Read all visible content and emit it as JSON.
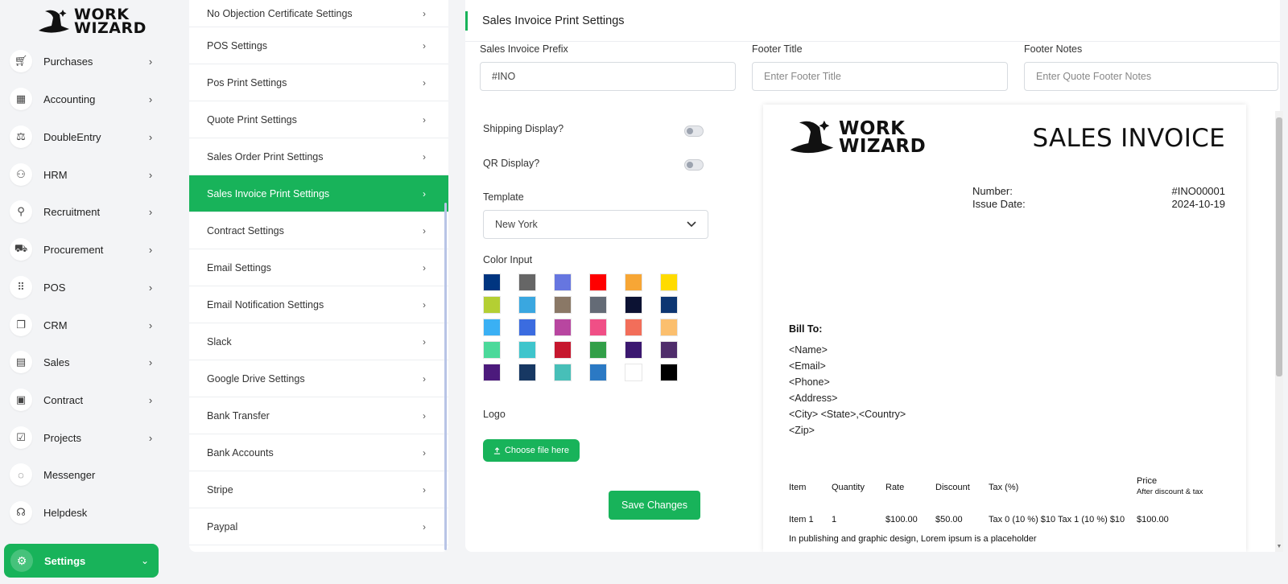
{
  "brand": {
    "line1": "WORK",
    "line2": "WIZARD"
  },
  "sidebar": {
    "items": [
      {
        "label": "Purchases",
        "icon": "cart-icon"
      },
      {
        "label": "Accounting",
        "icon": "grid-icon"
      },
      {
        "label": "DoubleEntry",
        "icon": "scale-icon"
      },
      {
        "label": "HRM",
        "icon": "users-icon"
      },
      {
        "label": "Recruitment",
        "icon": "user-plus-icon"
      },
      {
        "label": "Procurement",
        "icon": "cart-plus-icon"
      },
      {
        "label": "POS",
        "icon": "dots-grid-icon"
      },
      {
        "label": "CRM",
        "icon": "layers-icon"
      },
      {
        "label": "Sales",
        "icon": "file-icon"
      },
      {
        "label": "Contract",
        "icon": "save-icon"
      },
      {
        "label": "Projects",
        "icon": "check-square-icon"
      },
      {
        "label": "Messenger",
        "icon": "chat-icon"
      },
      {
        "label": "Helpdesk",
        "icon": "headset-icon"
      }
    ],
    "active": {
      "label": "Settings",
      "icon": "gear-icon"
    }
  },
  "settings_menu": [
    "No Objection Certificate Settings",
    "POS Settings",
    "Pos Print Settings",
    "Quote Print Settings",
    "Sales Order Print Settings",
    "Sales Invoice Print Settings",
    "Contract Settings",
    "Email Settings",
    "Email Notification Settings",
    "Slack",
    "Google Drive Settings",
    "Bank Transfer",
    "Bank Accounts",
    "Stripe",
    "Paypal"
  ],
  "settings_active_index": 5,
  "form": {
    "title": "Sales Invoice Print Settings",
    "prefix_label": "Sales Invoice Prefix",
    "prefix_value": "#INO",
    "footer_title_label": "Footer Title",
    "footer_title_placeholder": "Enter Footer Title",
    "footer_notes_label": "Footer Notes",
    "footer_notes_placeholder": "Enter Quote Footer Notes",
    "shipping_label": "Shipping Display?",
    "qr_label": "QR Display?",
    "template_label": "Template",
    "template_value": "New York",
    "color_label": "Color Input",
    "colors": [
      "#003580",
      "#666666",
      "#6676e0",
      "#ff0000",
      "#f7a635",
      "#ffdb00",
      "#b4cf33",
      "#3aa7e0",
      "#8a7866",
      "#646b76",
      "#0c1233",
      "#0d3672",
      "#3ab0f4",
      "#3b6ce0",
      "#b846a0",
      "#f04f86",
      "#f26e5a",
      "#fbbf6e",
      "#4bd99a",
      "#3fc5cc",
      "#c6172e",
      "#329f48",
      "#3b1870",
      "#4f2d6b",
      "#4c1a7c",
      "#173863",
      "#47bfb8",
      "#2b79c4",
      "#ffffff",
      "#000000"
    ],
    "logo_label": "Logo",
    "upload_label": "Choose file here",
    "save_label": "Save Changes"
  },
  "invoice": {
    "title": "SALES INVOICE",
    "number_label": "Number:",
    "number_value": "#INO00001",
    "date_label": "Issue Date:",
    "date_value": "2024-10-19",
    "bill_to": "Bill To:",
    "bill_lines": [
      "<Name>",
      "<Email>",
      "<Phone>",
      "<Address>",
      "<City> <State>,<Country>",
      "<Zip>"
    ],
    "headers": {
      "item": "Item",
      "quantity": "Quantity",
      "rate": "Rate",
      "discount": "Discount",
      "tax": "Tax (%)",
      "price": "Price",
      "price_sub": "After discount & tax"
    },
    "row": {
      "item": "Item 1",
      "quantity": "1",
      "rate": "$100.00",
      "discount": "$50.00",
      "tax": "Tax 0 (10 %) $10 Tax 1 (10 %) $10",
      "price": "$100.00"
    },
    "description": "In publishing and graphic design, Lorem ipsum is a placeholder"
  }
}
